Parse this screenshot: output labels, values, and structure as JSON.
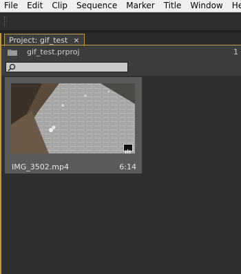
{
  "menu": [
    "File",
    "Edit",
    "Clip",
    "Sequence",
    "Marker",
    "Title",
    "Window",
    "Help"
  ],
  "panel": {
    "tab_label": "Project: gif_test",
    "close_glyph": "×",
    "project_file": "gif_test.prproj",
    "item_count": "1"
  },
  "search": {
    "value": "",
    "placeholder": ""
  },
  "clips": [
    {
      "name": "IMG_3502.mp4",
      "duration": "6:14",
      "badge": "video-audio-icon"
    }
  ],
  "colors": {
    "panel_accent": "#c29b3b",
    "menu_bg": "#f0f0f0",
    "panel_bg": "#3d3d3d",
    "content_bg": "#2f2f2f"
  },
  "icons": [
    "folder-icon",
    "search-icon",
    "close-icon",
    "video-audio-icon"
  ]
}
